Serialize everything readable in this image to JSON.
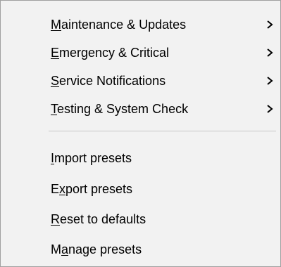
{
  "menu": {
    "submenus": [
      {
        "accel": "M",
        "rest": "aintenance & Updates",
        "chevron": "chevron-right-icon"
      },
      {
        "accel": "E",
        "rest": "mergency & Critical",
        "chevron": "chevron-right-icon"
      },
      {
        "accel": "S",
        "rest": "ervice Notifications",
        "chevron": "chevron-right-icon"
      },
      {
        "accel": "T",
        "rest": "esting & System Check",
        "chevron": "chevron-right-icon"
      }
    ],
    "actions": [
      {
        "accel": "I",
        "rest": "mport presets"
      },
      {
        "pre": "E",
        "accel": "x",
        "rest": "port presets"
      },
      {
        "accel": "R",
        "rest": "eset to defaults"
      },
      {
        "pre": "M",
        "accel": "a",
        "rest": "nage presets"
      }
    ]
  }
}
